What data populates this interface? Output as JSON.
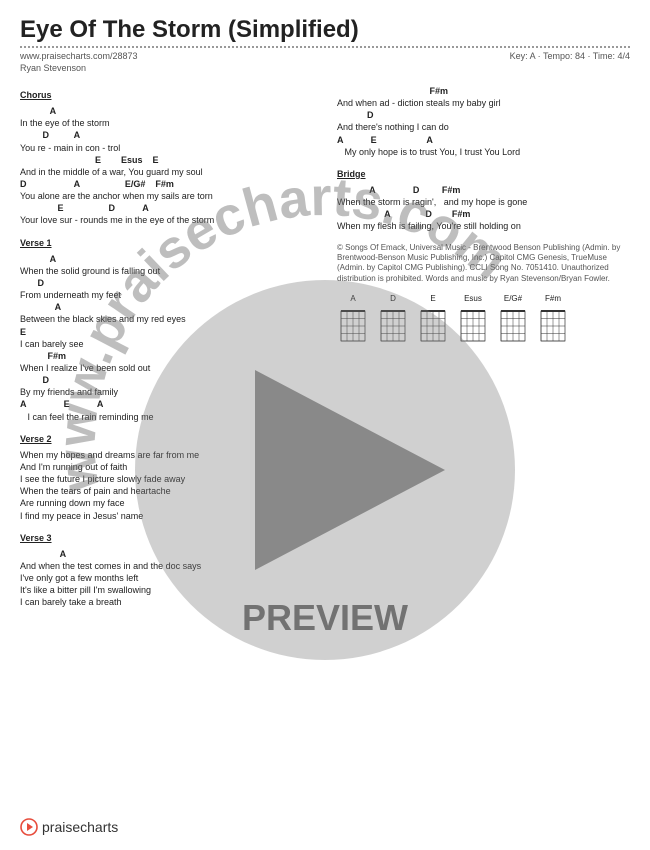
{
  "title": "Eye Of The Storm (Simplified)",
  "url": "www.praisecharts.com/28873",
  "artist": "Ryan Stevenson",
  "meta": "Key: A · Tempo: 84 · Time: 4/4",
  "left": {
    "chorus": {
      "label": "Chorus",
      "lines": [
        {
          "c": "            A",
          "l": "In the eye of the storm"
        },
        {
          "c": "         D          A",
          "l": "You re - main in con - trol"
        },
        {
          "c": "                              E        Esus    E",
          "l": "And in the middle of a war, You guard my soul"
        },
        {
          "c": "D                   A                  E/G#    F#m",
          "l": "You alone are the anchor when my sails are torn"
        },
        {
          "c": "               E                  D           A",
          "l": "Your love sur - rounds me in the eye of the storm"
        }
      ]
    },
    "verse1": {
      "label": "Verse 1",
      "lines": [
        {
          "c": "            A",
          "l": "When the solid ground is falling out"
        },
        {
          "c": "       D",
          "l": "From underneath my feet"
        },
        {
          "c": "              A",
          "l": "Between the black skies and my red eyes"
        },
        {
          "c": "E",
          "l": "I can barely see"
        },
        {
          "c": "           F#m",
          "l": "When I realize I've been sold out"
        },
        {
          "c": "         D",
          "l": "By my friends and family"
        },
        {
          "c": "A               E           A",
          "l": "   I can feel the rain reminding me"
        }
      ]
    },
    "verse2": {
      "label": "Verse 2",
      "lines": [
        {
          "c": "",
          "l": "When my hopes and dreams are far from me"
        },
        {
          "c": "",
          "l": "And I'm running out of faith"
        },
        {
          "c": "",
          "l": "I see the future I picture slowly fade away"
        },
        {
          "c": "",
          "l": "When the tears of pain and heartache"
        },
        {
          "c": "",
          "l": "Are running down my face"
        },
        {
          "c": "",
          "l": "I find my peace in Jesus' name"
        }
      ]
    },
    "verse3": {
      "label": "Verse 3",
      "lines": [
        {
          "c": "                A",
          "l": "And when the test comes in and the doc says"
        },
        {
          "c": "",
          "l": "I've only got a few months left"
        },
        {
          "c": "",
          "l": "It's like a bitter pill I'm swallowing"
        },
        {
          "c": "",
          "l": "I can barely take a breath"
        }
      ]
    }
  },
  "right": {
    "cont": {
      "lines": [
        {
          "c": "                                     F#m",
          "l": "And when ad - diction steals my baby girl"
        },
        {
          "c": "            D",
          "l": "And there's nothing I can do"
        },
        {
          "c": "A           E                    A",
          "l": "   My only hope is to trust You, I trust You Lord"
        }
      ]
    },
    "bridge": {
      "label": "Bridge",
      "lines": [
        {
          "c": "             A               D         F#m",
          "l": "When the storm is ragin',   and my hope is gone"
        },
        {
          "c": "                   A              D        F#m",
          "l": "When my flesh is failing, You're still holding on"
        }
      ]
    },
    "copyright": "© Songs Of Emack, Universal Music - Brentwood Benson Publishing (Admin. by Brentwood-Benson Music Publishing, Inc.) Capitol CMG Genesis, TrueMuse (Admin. by Capitol CMG Publishing). CCLI Song No. 7051410. Unauthorized distribution is prohibited. Words and music by Ryan Stevenson/Bryan Fowler."
  },
  "chord_diagrams": [
    "A",
    "D",
    "E",
    "Esus",
    "E/G#",
    "F#m"
  ],
  "footer_brand": "praisecharts",
  "watermark": "www.praisecharts.com",
  "preview_label": "PREVIEW"
}
